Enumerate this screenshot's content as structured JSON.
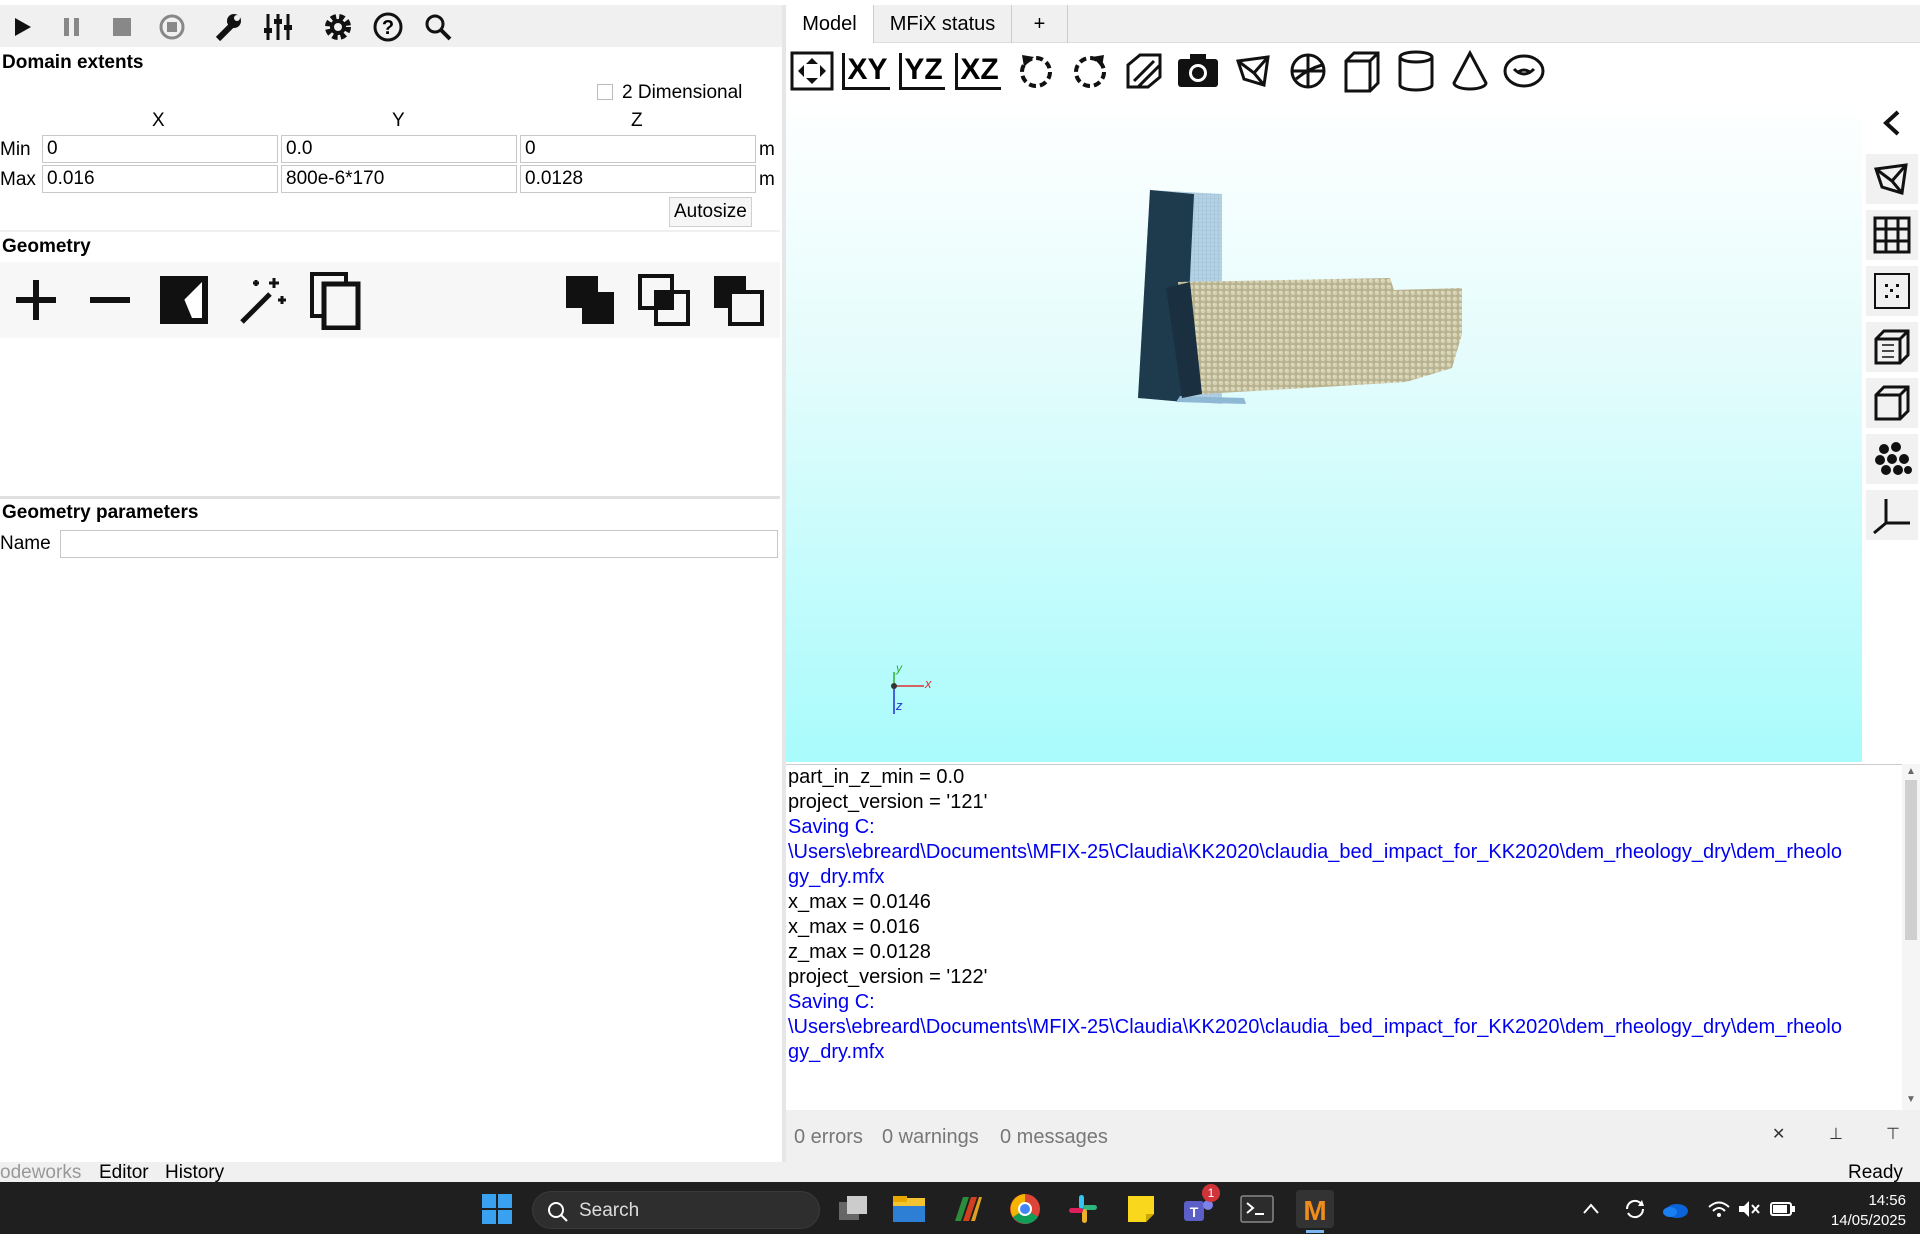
{
  "toolbar": {
    "icons": [
      "play-icon",
      "pause-icon",
      "stop-icon",
      "reset-icon",
      "wrench-icon",
      "sliders-icon",
      "gear-icon",
      "help-icon",
      "search-icon"
    ]
  },
  "domain": {
    "title": "Domain extents",
    "two_d_label": "2 Dimensional",
    "col_x": "X",
    "col_y": "Y",
    "col_z": "Z",
    "min_label": "Min",
    "max_label": "Max",
    "min_x": "0",
    "min_y": "0.0",
    "min_z": "0",
    "max_x": "0.016",
    "max_y": "800e-6*170",
    "max_z": "0.0128",
    "unit_min": "m",
    "unit_max": "m",
    "autosize_label": "Autosize"
  },
  "geometry": {
    "title": "Geometry"
  },
  "geom_params": {
    "title": "Geometry parameters",
    "name_label": "Name",
    "name_value": ""
  },
  "tabs": {
    "model": "Model",
    "status": "MFiX status",
    "add": "+"
  },
  "view_toolbar": {
    "xy": "XY",
    "yz": "YZ",
    "xz": "XZ"
  },
  "axes": {
    "x": "x",
    "y": "y",
    "z": "z"
  },
  "console": {
    "lines": [
      {
        "text": "part_in_z_min = 0.0",
        "color": "#000000"
      },
      {
        "text": "project_version = '121'",
        "color": "#000000"
      },
      {
        "text": "Saving C:",
        "color": "#0000ee"
      },
      {
        "text": "\\Users\\ebreard\\Documents\\MFIX-25\\Claudia\\KK2020\\claudia_bed_impact_for_KK2020\\dem_rheology_dry\\dem_rheolo",
        "color": "#0000ee"
      },
      {
        "text": "gy_dry.mfx",
        "color": "#0000ee"
      },
      {
        "text": "x_max = 0.0146",
        "color": "#000000"
      },
      {
        "text": "x_max = 0.016",
        "color": "#000000"
      },
      {
        "text": "z_max = 0.0128",
        "color": "#000000"
      },
      {
        "text": "project_version = '122'",
        "color": "#000000"
      },
      {
        "text": "Saving C:",
        "color": "#0000ee"
      },
      {
        "text": "\\Users\\ebreard\\Documents\\MFIX-25\\Claudia\\KK2020\\claudia_bed_impact_for_KK2020\\dem_rheology_dry\\dem_rheolo",
        "color": "#0000ee"
      },
      {
        "text": "gy_dry.mfx",
        "color": "#0000ee"
      }
    ]
  },
  "messages": {
    "errors": "0 errors",
    "warnings": "0 warnings",
    "messages": "0 messages"
  },
  "statusbar": {
    "tab_codeworks": "odeworks",
    "tab_editor": "Editor",
    "tab_history": "History",
    "status": "Ready"
  },
  "taskbar": {
    "search_label": "Search",
    "time": "14:56",
    "date": "14/05/2025",
    "teams_badge": "1"
  }
}
